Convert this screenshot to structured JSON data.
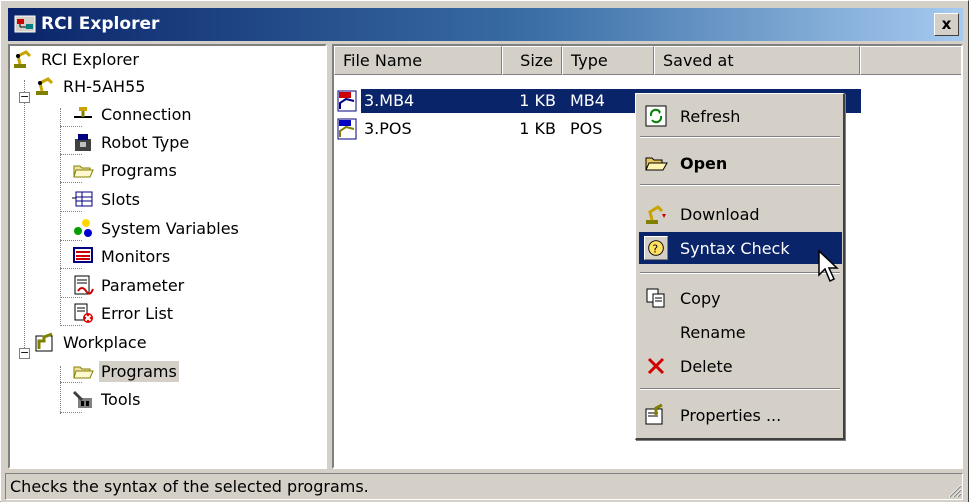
{
  "window": {
    "title": "RCI Explorer",
    "close_label": "x"
  },
  "tree": {
    "root": "RCI Explorer",
    "robot": "RH-5AH55",
    "robot_children": [
      "Connection",
      "Robot Type",
      "Programs",
      "Slots",
      "System Variables",
      "Monitors",
      "Parameter",
      "Error List"
    ],
    "workplace": "Workplace",
    "workplace_children": [
      "Programs",
      "Tools"
    ],
    "selected": "Programs (Workplace)"
  },
  "list": {
    "columns": [
      "File Name",
      "Size",
      "Type",
      "Saved at"
    ],
    "rows": [
      {
        "name": "3.MB4",
        "size": "1 KB",
        "type": "MB4",
        "selected": true
      },
      {
        "name": "3.POS",
        "size": "1 KB",
        "type": "POS",
        "selected": false
      }
    ]
  },
  "context_menu": {
    "items": [
      {
        "label": "Refresh",
        "icon": "refresh-icon"
      },
      {
        "label": "Open",
        "icon": "open-folder-icon",
        "bold": true
      },
      {
        "label": "Download",
        "icon": "download-icon"
      },
      {
        "label": "Syntax Check",
        "icon": "syntax-check-icon",
        "highlighted": true
      },
      {
        "label": "Copy",
        "icon": "copy-icon"
      },
      {
        "label": "Rename",
        "icon": ""
      },
      {
        "label": "Delete",
        "icon": "delete-icon"
      },
      {
        "label": "Properties ...",
        "icon": "properties-icon"
      }
    ]
  },
  "status": {
    "text": "Checks the syntax of the selected programs."
  },
  "colors": {
    "title_gradient_start": "#0a246a",
    "title_gradient_end": "#a6caf0",
    "selection": "#0a246a",
    "face": "#d4d0c8"
  }
}
